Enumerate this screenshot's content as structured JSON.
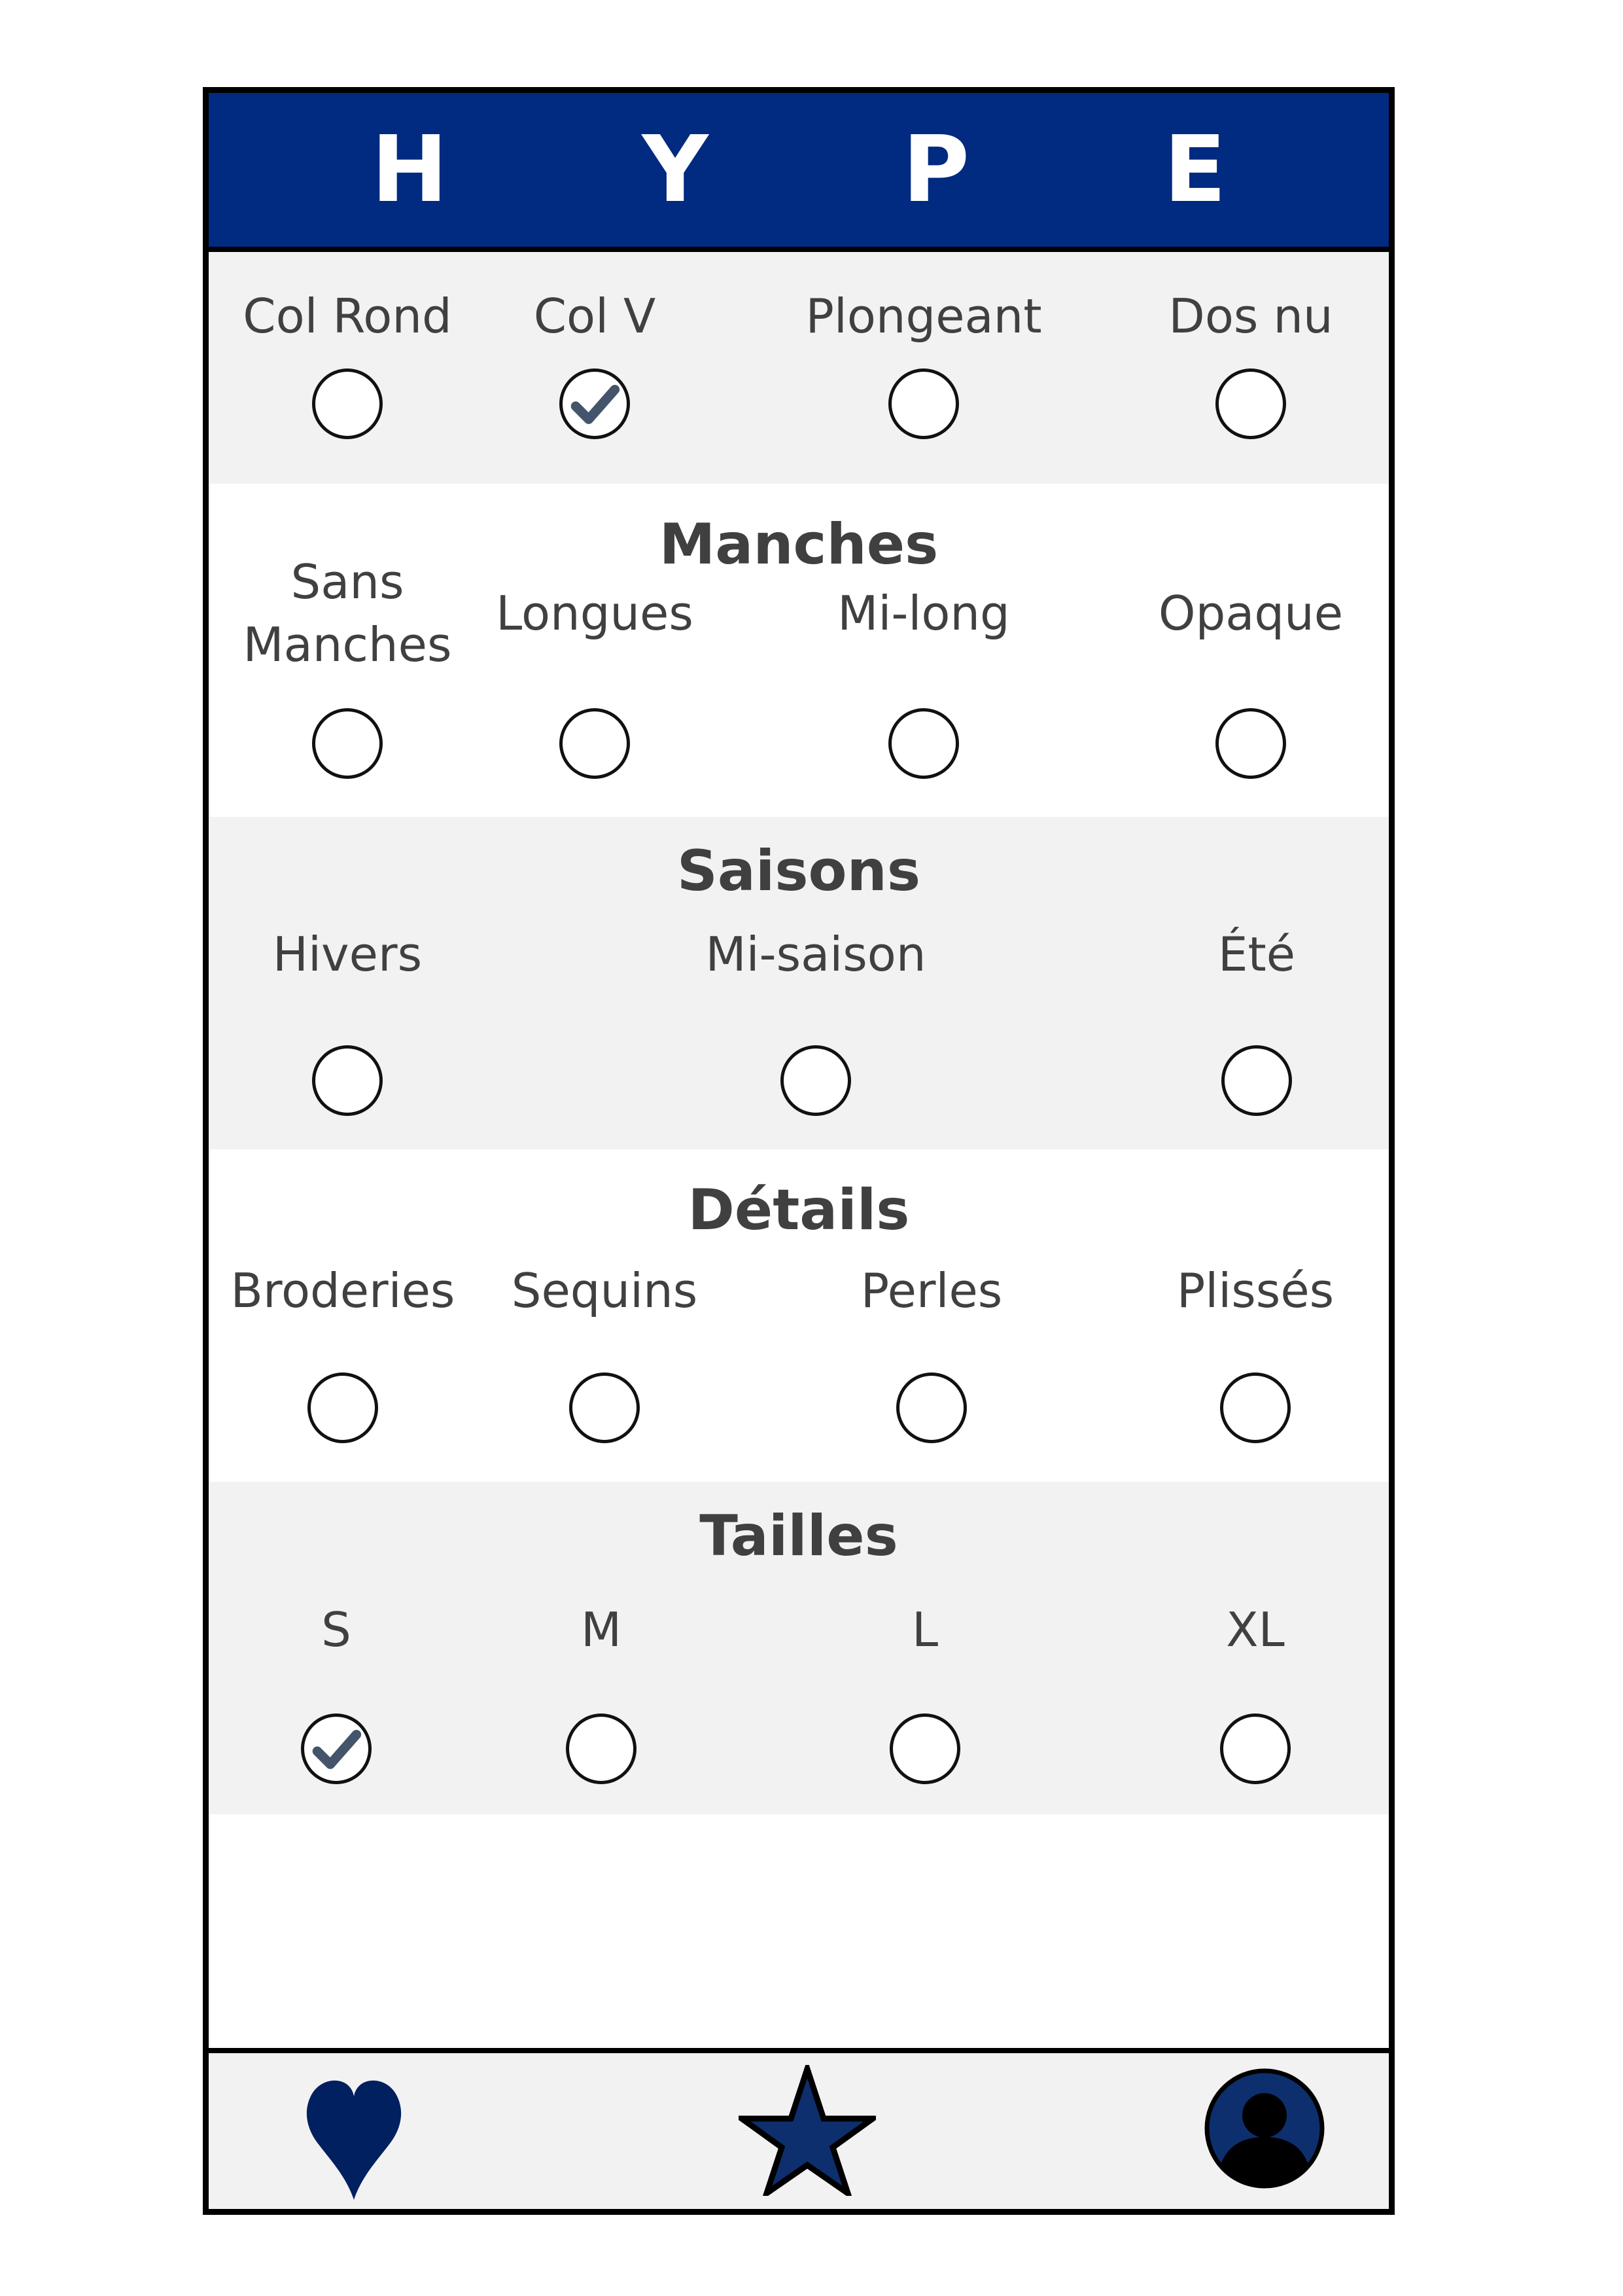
{
  "app": {
    "title": "H Y P E",
    "colors": {
      "brand": "#012A81",
      "section_bg": "#F2F2F2",
      "check": "#44546A",
      "text": "#404040"
    }
  },
  "sections": [
    {
      "id": "neckline",
      "title": "",
      "bg": "#F2F2F2",
      "options": [
        {
          "label": "Col Rond",
          "checked": false
        },
        {
          "label": "Col V",
          "checked": true
        },
        {
          "label": "Plongeant",
          "checked": false
        },
        {
          "label": "Dos nu",
          "checked": false
        }
      ]
    },
    {
      "id": "manches",
      "title": "Manches",
      "bg": "#FFFFFF",
      "options": [
        {
          "label": "Sans\nManches",
          "checked": false
        },
        {
          "label": "Longues",
          "checked": false
        },
        {
          "label": "Mi-long",
          "checked": false
        },
        {
          "label": "Opaque",
          "checked": false
        }
      ]
    },
    {
      "id": "saisons",
      "title": "Saisons",
      "bg": "#F2F2F2",
      "options": [
        {
          "label": "Hivers",
          "checked": false
        },
        {
          "label": "Mi-saison",
          "checked": false
        },
        {
          "label": "Été",
          "checked": false
        }
      ]
    },
    {
      "id": "details",
      "title": "Détails",
      "bg": "#FFFFFF",
      "options": [
        {
          "label": "Broderies",
          "checked": false
        },
        {
          "label": "Sequins",
          "checked": false
        },
        {
          "label": "Perles",
          "checked": false
        },
        {
          "label": "Plissés",
          "checked": false
        }
      ]
    },
    {
      "id": "tailles",
      "title": "Tailles",
      "bg": "#F2F2F2",
      "options": [
        {
          "label": "S",
          "checked": true
        },
        {
          "label": "M",
          "checked": false
        },
        {
          "label": "L",
          "checked": false
        },
        {
          "label": "XL",
          "checked": false
        }
      ]
    }
  ],
  "bottom_nav": {
    "bg": "#F2F2F2",
    "items": [
      {
        "icon": "heart-icon",
        "color": "#012060"
      },
      {
        "icon": "star-icon",
        "color": "#0E2F6E"
      },
      {
        "icon": "profile-icon",
        "color": "#0E2F6E"
      }
    ]
  }
}
